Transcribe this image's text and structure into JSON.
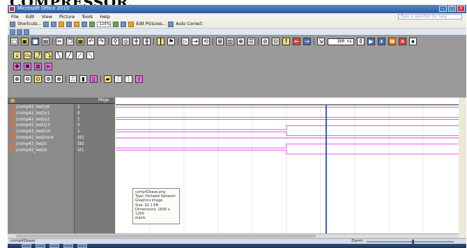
{
  "heading": "COMPRESSOR.",
  "window": {
    "title": "Microsoft Office 2010",
    "controls": [
      "–",
      "□",
      "×"
    ]
  },
  "menu": [
    "File",
    "Edit",
    "View",
    "Picture",
    "Tools",
    "Help"
  ],
  "help_placeholder": "Type a question for help",
  "toolbar": {
    "shortcuts": "Shortcuts...",
    "zoom": "125%",
    "edit_pictures": "Edit Pictures...",
    "auto_correct": "Auto Correct"
  },
  "simulator": {
    "time_value": "100 ns",
    "names_header_label": "Msgs",
    "signals": [
      {
        "name": "/comp42_test/y0",
        "value": "1"
      },
      {
        "name": "/comp42_test/y1",
        "value": "0"
      },
      {
        "name": "/comp42_test/y2",
        "value": "1"
      },
      {
        "name": "/comp42_test/y3",
        "value": "0"
      },
      {
        "name": "/comp42_test/cin",
        "value": "1"
      },
      {
        "name": "/comp42_test/cout",
        "value": "St1"
      },
      {
        "name": "/comp42_test/c",
        "value": "St0"
      },
      {
        "name": "/comp42_test/s",
        "value": "St1"
      }
    ],
    "waveform_color": "#e040e0",
    "cursor_color": "#1f4ad8"
  },
  "tooltip": {
    "lines": [
      "comp42base.png",
      "Type: Portable Network",
      "Graphics Image",
      "Size: 92.1 KB",
      "Dimensions: 1600 x 1200",
      "pixels"
    ]
  },
  "status": {
    "left": "comp42base",
    "zoom_label": "Zoom:"
  }
}
